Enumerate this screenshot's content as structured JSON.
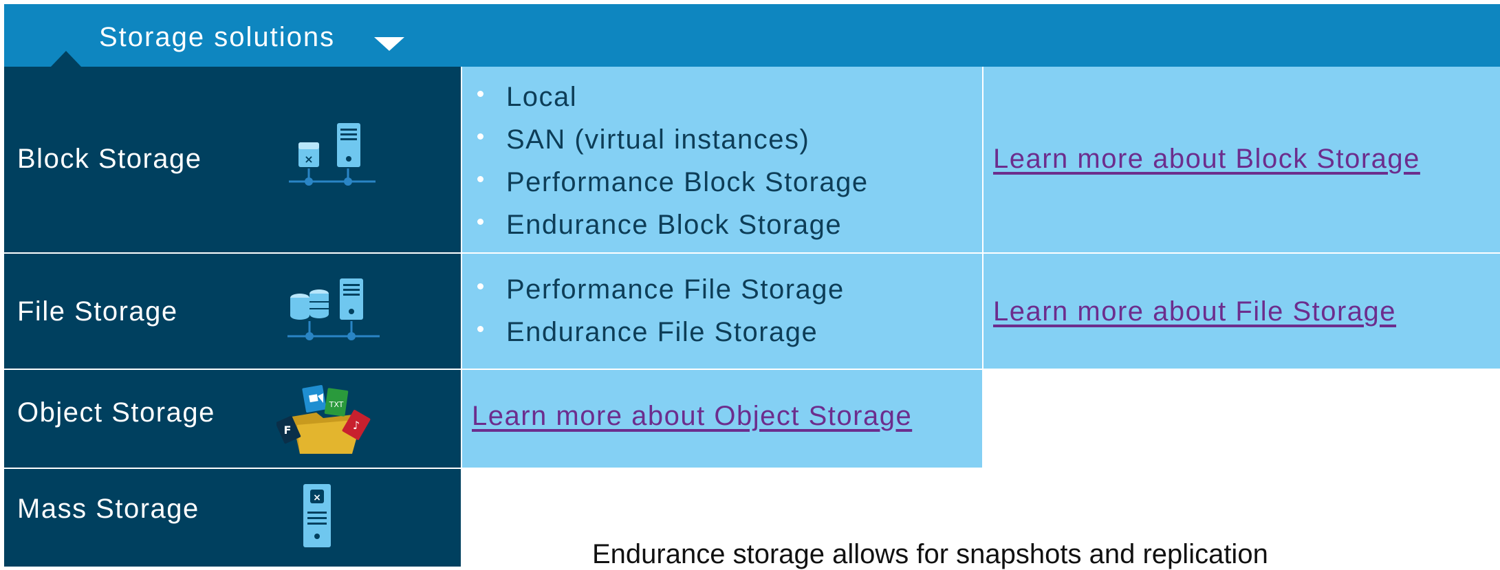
{
  "header": {
    "title": "Storage solutions",
    "menu_icon": "chevron-down-icon"
  },
  "categories": [
    {
      "label": "Block Storage",
      "icon": "block-storage-icon"
    },
    {
      "label": "File Storage",
      "icon": "file-storage-icon"
    },
    {
      "label": "Object Storage",
      "icon": "object-storage-icon"
    },
    {
      "label": "Mass Storage",
      "icon": "mass-storage-icon"
    }
  ],
  "block": {
    "items": [
      "Local",
      "SAN (virtual instances)",
      "Performance Block Storage",
      "Endurance Block Storage"
    ],
    "link": "Learn more about Block Storage"
  },
  "file": {
    "items": [
      "Performance File Storage",
      "Endurance File Storage"
    ],
    "link": "Learn more about File Storage"
  },
  "object": {
    "link": "Learn more about Object Storage"
  },
  "footnote": "Endurance storage allows for snapshots and replication",
  "colors": {
    "header": "#0e86c0",
    "category_bg": "#00405f",
    "cell_bg": "#84d0f4",
    "link": "#6c2d8d"
  }
}
